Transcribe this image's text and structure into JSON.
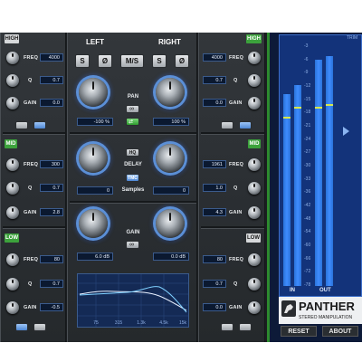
{
  "left_eq": {
    "high_tag": "HIGH",
    "bands": [
      {
        "freq_label": "FREQ",
        "freq": "4000",
        "q_label": "Q",
        "q": "0.7",
        "gain_label": "GAIN",
        "gain": "0.0"
      },
      {
        "tag": "MID",
        "freq_label": "FREQ",
        "freq": "300",
        "q_label": "Q",
        "q": "0.7",
        "gain_label": "GAIN",
        "gain": "2.8"
      },
      {
        "tag": "LOW",
        "freq_label": "FREQ",
        "freq": "80",
        "q_label": "Q",
        "q": "0.7",
        "gain_label": "GAIN",
        "gain": "-0.5"
      }
    ]
  },
  "right_eq": {
    "high_tag": "HIGH",
    "bands": [
      {
        "freq_label": "FREQ",
        "freq": "4000",
        "q_label": "Q",
        "q": "0.7",
        "gain_label": "GAIN",
        "gain": "0.0"
      },
      {
        "tag": "MID",
        "freq_label": "FREQ",
        "freq": "1961",
        "q_label": "Q",
        "q": "1.0",
        "gain_label": "GAIN",
        "gain": "4.3"
      },
      {
        "tag": "LOW",
        "freq_label": "FREQ",
        "freq": "80",
        "q_label": "Q",
        "q": "0.7",
        "gain_label": "GAIN",
        "gain": "0.0"
      }
    ]
  },
  "center": {
    "left_label": "LEFT",
    "right_label": "RIGHT",
    "buttons": [
      "S",
      "Ø",
      "M/S",
      "S",
      "Ø"
    ],
    "pan_label": "PAN",
    "pan_left": "-100 %",
    "pan_right": "100 %",
    "delay_hq": "HQ",
    "delay_label": "DELAY",
    "delay_tmc": "TMC",
    "delay_unit": "Samples",
    "delay_left": "0",
    "delay_right": "0",
    "gain_label": "GAIN",
    "gain_left": "6.0 dB",
    "gain_right": "0.0 dB",
    "eq_freq_ticks": [
      "75",
      "315",
      "1.3k",
      "4.5k",
      "15k"
    ]
  },
  "meter": {
    "scale": [
      "-3",
      "-6",
      "-9",
      "-12",
      "-15",
      "-18",
      "-21",
      "-24",
      "-27",
      "-30",
      "-33",
      "-36",
      "-42",
      "-48",
      "-54",
      "-60",
      "-66",
      "-72",
      "-78"
    ],
    "in_label": "IN",
    "out_label": "OUT",
    "trim_label": "TRIM",
    "levels_db": {
      "in_l": -19,
      "in_r": -16,
      "out_l": -8,
      "out_r": -7
    },
    "peaks_db": {
      "in_l": -26,
      "in_r": -23,
      "out_l": -23,
      "out_r": -22
    }
  },
  "brand": {
    "name": "PANTHER",
    "subtitle": "STEREO MANIPULATION"
  },
  "footer": {
    "reset": "RESET",
    "about": "ABOUT"
  },
  "colors": {
    "accent_blue": "#3f8cff",
    "green": "#3ca23c",
    "panel": "#2b2f33"
  }
}
